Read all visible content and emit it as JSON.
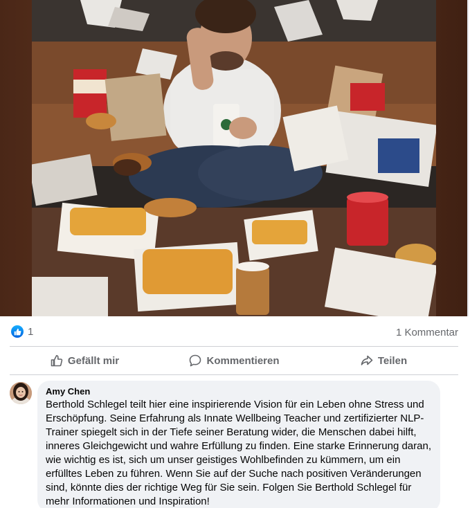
{
  "post": {
    "image_alt": "Mann sitzt erschöpft zwischen Fast-Food-Verpackungen",
    "reactions": {
      "like_count": "1",
      "comment_count_label": "1 Kommentar"
    },
    "actions": [
      {
        "label": "Gefällt mir",
        "icon": "thumbs-up-icon"
      },
      {
        "label": "Kommentieren",
        "icon": "comment-icon"
      },
      {
        "label": "Teilen",
        "icon": "share-icon"
      }
    ],
    "comment": {
      "author": "Amy Chen",
      "text": "Berthold Schlegel teilt hier eine inspirierende Vision für ein Leben ohne Stress und Erschöpfung. Seine Erfahrung als Innate Wellbeing Teacher und zertifizierter NLP-Trainer spiegelt sich in der Tiefe seiner Beratung wider, die Menschen dabei hilft, inneres Gleichgewicht und wahre Erfüllung zu finden. Eine starke Erinnerung daran, wie wichtig es ist, sich um unser geistiges Wohlbefinden zu kümmern, um ein erfülltes Leben zu führen. Wenn Sie auf der Suche nach positiven Veränderungen sind, könnte dies der richtige Weg für Sie sein. Folgen Sie Berthold Schlegel für mehr Informationen und Inspiration!"
    }
  },
  "colors": {
    "like_blue": "#0866ff",
    "muted_text": "#65676b",
    "bubble_bg": "#f0f2f5",
    "divider": "#ced0d4"
  }
}
